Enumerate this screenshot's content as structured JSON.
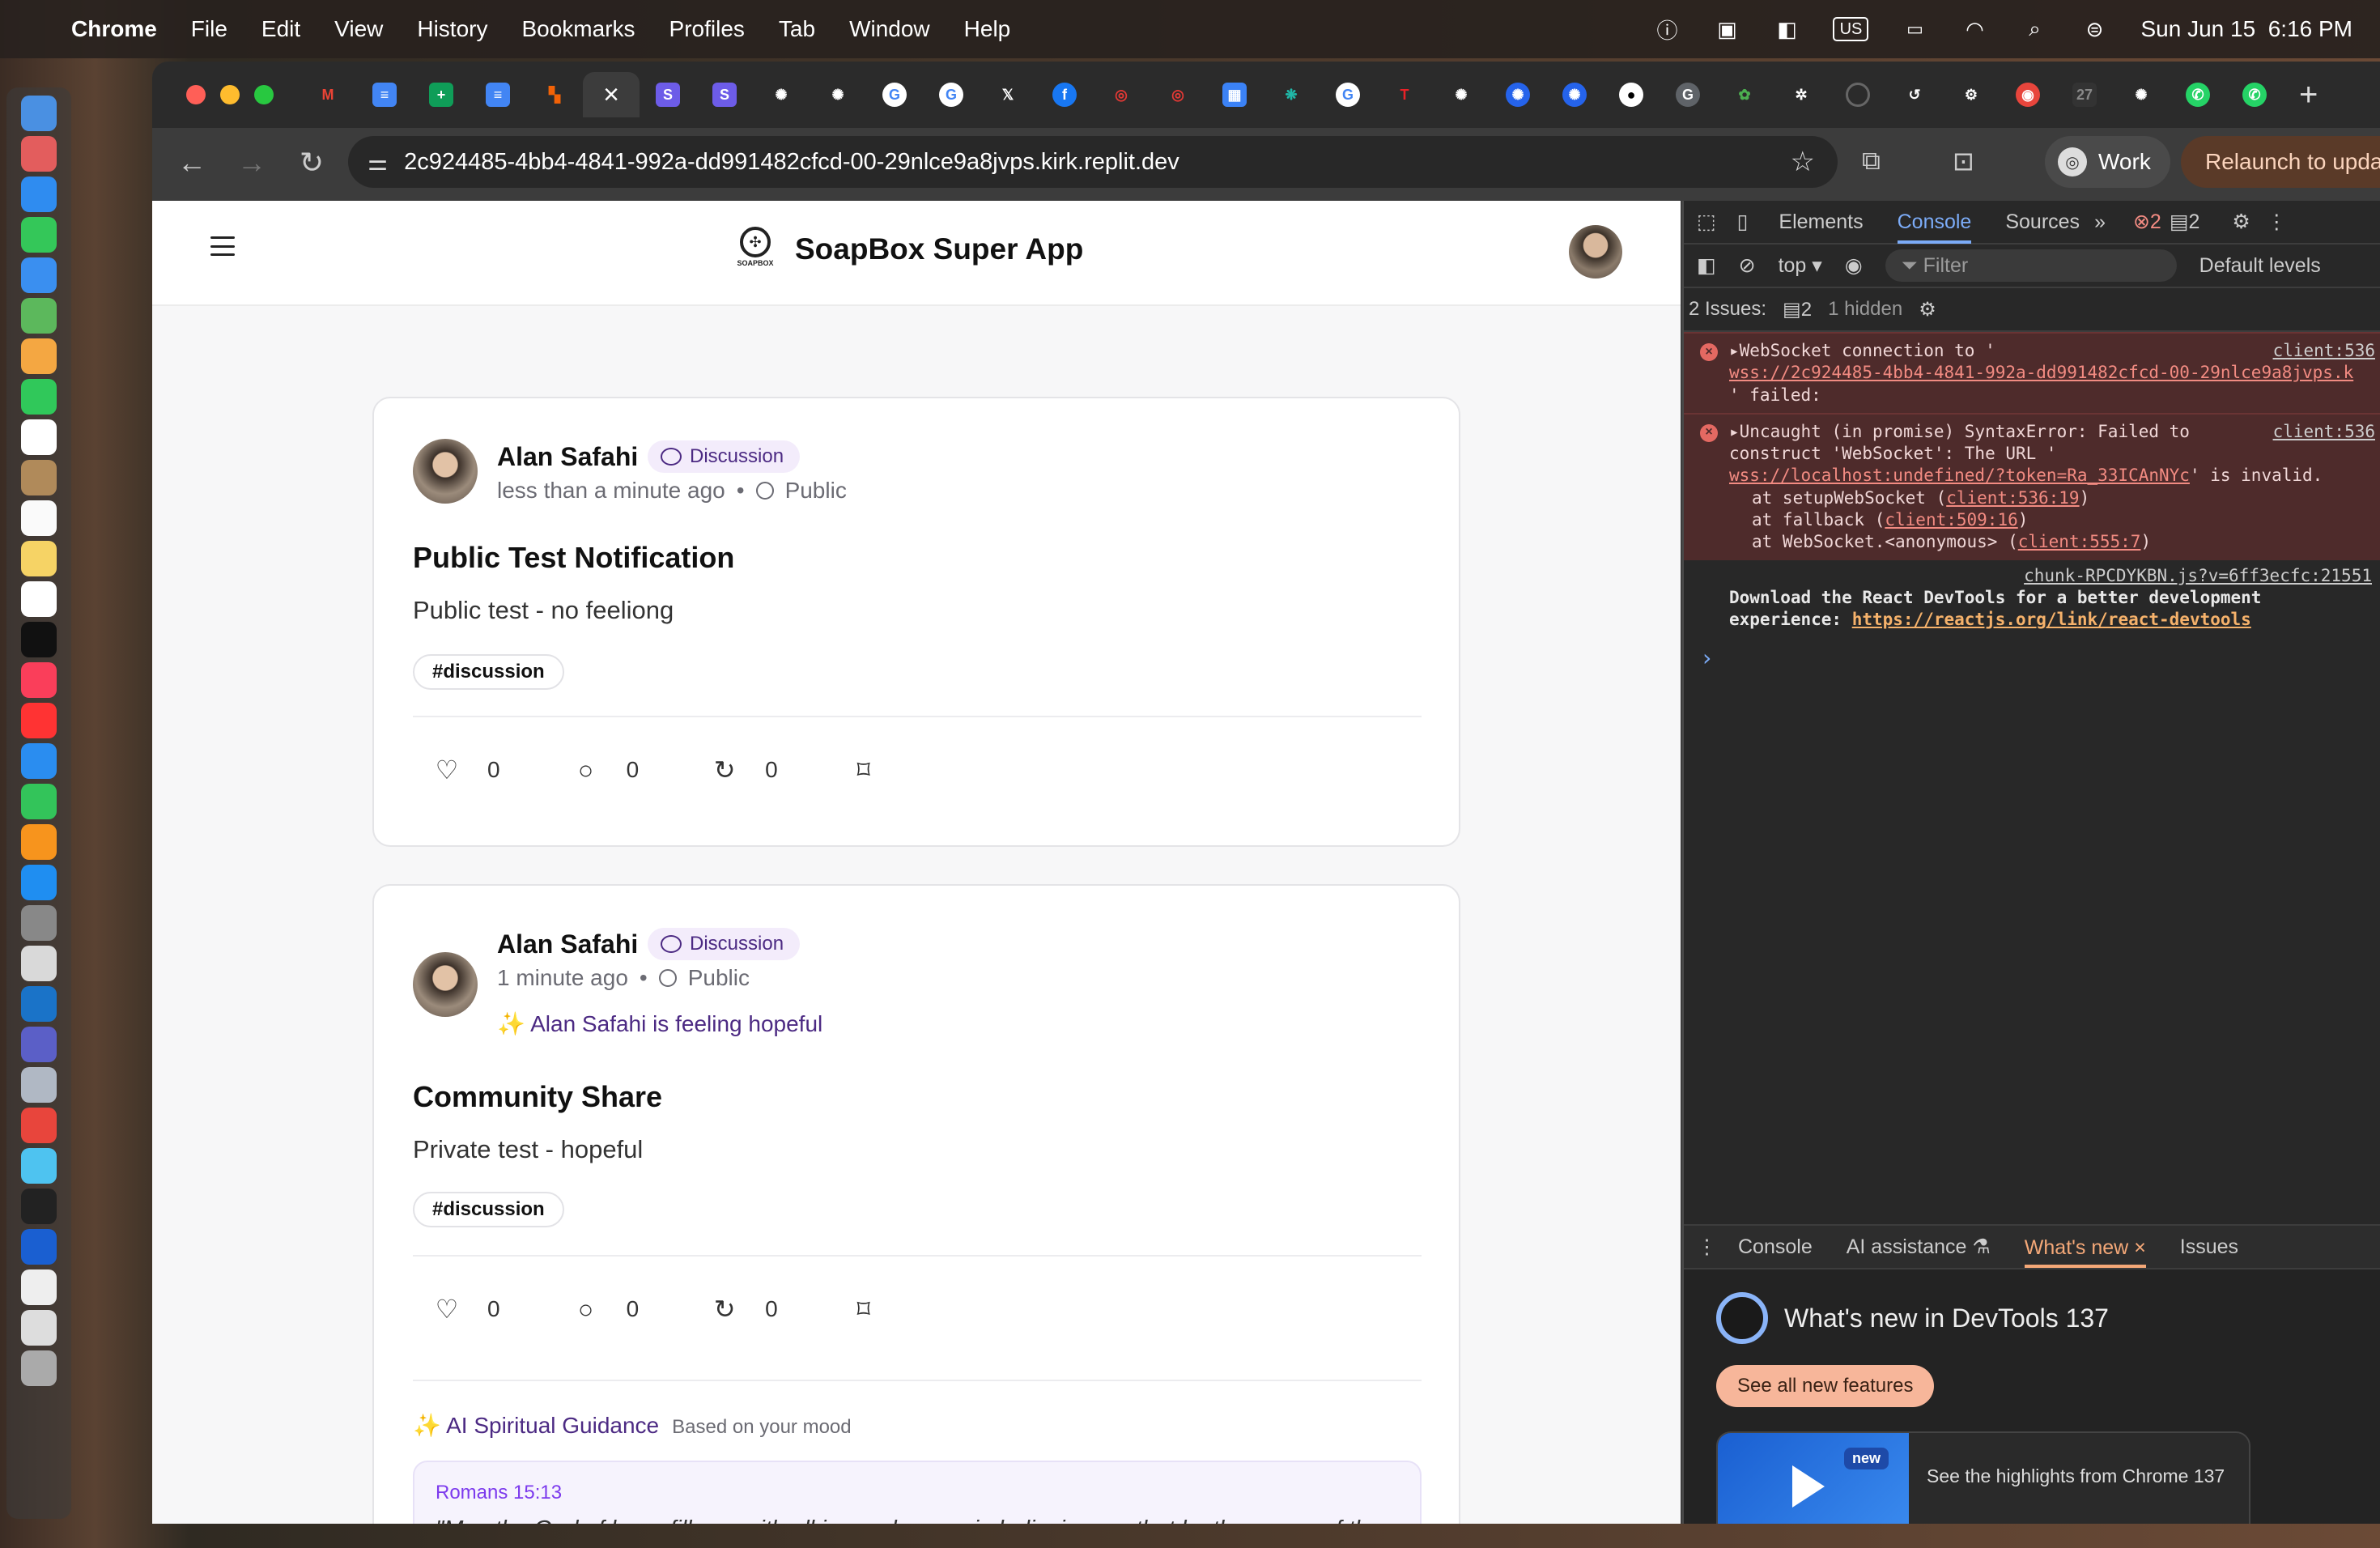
{
  "menubar": {
    "items": [
      "Chrome",
      "File",
      "Edit",
      "View",
      "History",
      "Bookmarks",
      "Profiles",
      "Tab",
      "Window",
      "Help"
    ],
    "input_source": "US",
    "datetime": "Sun Jun 15  6:16 PM"
  },
  "browser": {
    "url": "2c924485-4bb4-4841-992a-dd991482cfcd-00-29nlce9a8jvps.kirk.replit.dev",
    "profile_label": "Work",
    "relaunch_label": "Relaunch to update"
  },
  "app": {
    "title": "SoapBox Super App",
    "logo_text": "SOAPBOX"
  },
  "posts": [
    {
      "author": "Alan Safahi",
      "category": "Discussion",
      "time": "less than a minute ago",
      "visibility": "Public",
      "mood": "",
      "title": "Public Test Notification",
      "body": "Public test - no feeliong",
      "tag": "#discussion",
      "likes": "0",
      "comments": "0",
      "reposts": "0"
    },
    {
      "author": "Alan Safahi",
      "category": "Discussion",
      "time": "1 minute ago",
      "visibility": "Public",
      "mood": "✨ Alan Safahi is feeling hopeful",
      "title": "Community Share",
      "body": "Private test - hopeful",
      "tag": "#discussion",
      "likes": "0",
      "comments": "0",
      "reposts": "0",
      "guidance_label": "✨ AI Spiritual Guidance",
      "guidance_sub": "Based on your mood",
      "verse_ref": "Romans 15:13",
      "verse_text": "\"May the God of hope fill you with all joy and peace in believing, so that by the power of the Holy Spirit you may abound in hope.\""
    }
  ],
  "devtools": {
    "tabs": [
      "Elements",
      "Console",
      "Sources"
    ],
    "error_count": "2",
    "message_count": "2",
    "context": "top",
    "filter_placeholder": "Filter",
    "levels": "Default levels",
    "issues_label": "2 Issues:",
    "issues_count": "2",
    "hidden": "1 hidden",
    "console": {
      "err1_line1": "WebSocket connection to '",
      "err1_link": "wss://2c924485-4bb4-4841-992a-dd991482cfcd-00-29nlce9a8jvps.k",
      "err1_line3": "' failed:",
      "err1_src": "client:536",
      "err2_line1": "Uncaught (in promise) SyntaxError: Failed to",
      "err2_line2": "construct 'WebSocket': The URL '",
      "err2_link": "wss://localhost:undefined/?token=Ra_33ICAnNYc",
      "err2_tail": "' is invalid.",
      "err2_src": "client:536",
      "stack1_pre": "at setupWebSocket (",
      "stack1_link": "client:536:19",
      "stack2_pre": "at fallback (",
      "stack2_link": "client:509:16",
      "stack3_pre": "at WebSocket.<anonymous> (",
      "stack3_link": "client:555:7",
      "info_src": "chunk-RPCDYKBN.js?v=6ff3ecfc:21551",
      "info_line1": "Download the React DevTools for a better development",
      "info_line2_pre": "experience: ",
      "info_link": "https://reactjs.org/link/react-devtools"
    },
    "drawer_tabs": [
      "Console",
      "AI assistance",
      "What's new",
      "Issues"
    ],
    "whats_new_title": "What's new in DevTools 137",
    "see_all": "See all new features",
    "video_badge": "new",
    "video_title": "See the highlights from Chrome 137"
  }
}
